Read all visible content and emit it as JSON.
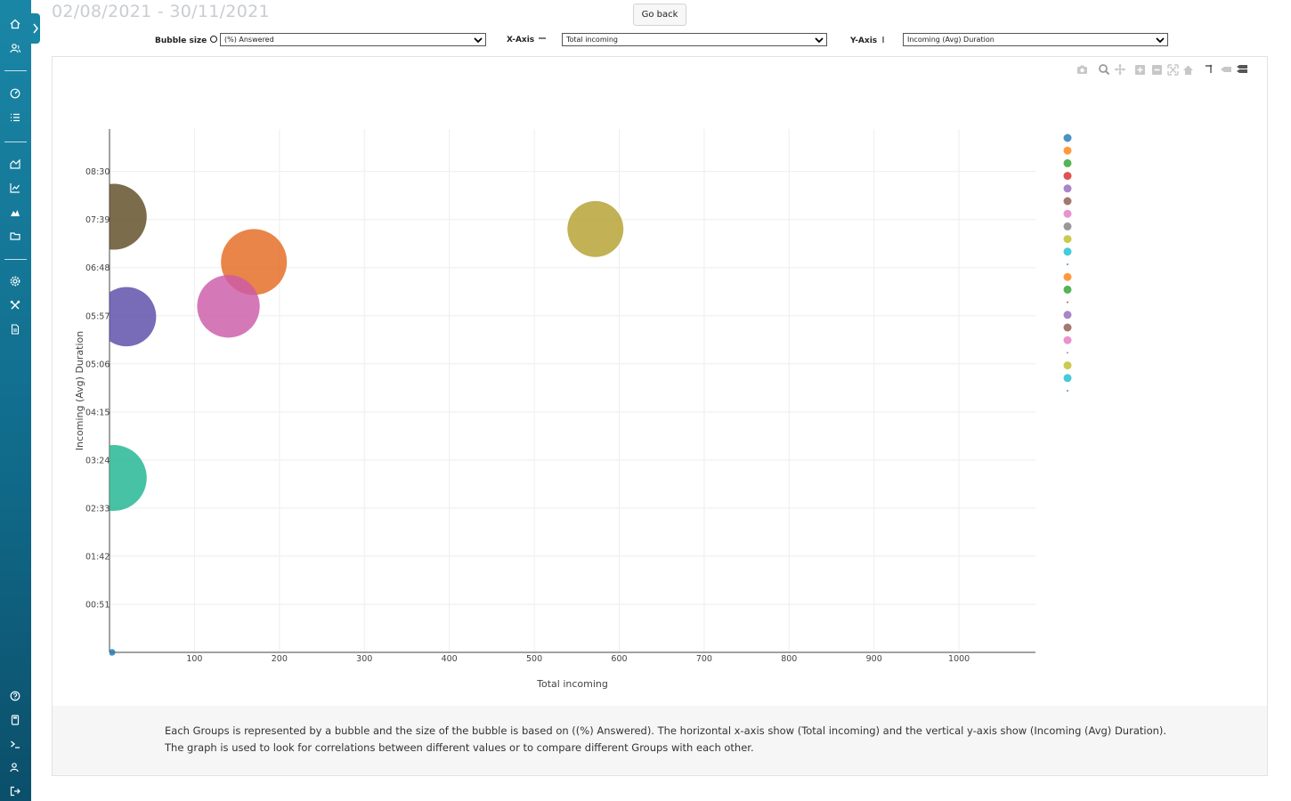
{
  "header": {
    "date_range": "02/08/2021 - 30/11/2021",
    "go_back_label": "Go back"
  },
  "controls": {
    "bubble_size": {
      "label": "Bubble size",
      "value": "(%) Answered"
    },
    "x_axis": {
      "label": "X-Axis",
      "value": "Total incoming"
    },
    "y_axis": {
      "label": "Y-Axis",
      "value": "Incoming (Avg) Duration"
    }
  },
  "sidebar": {
    "top_icons": [
      "home-icon",
      "user-group-icon"
    ],
    "middle_icons": [
      "dashboard-icon",
      "list-icon"
    ],
    "report_icons": [
      "area-chart-icon",
      "line-chart-icon",
      "mountain-chart-icon",
      "folder-icon"
    ],
    "settings_icons": [
      "gear-icon",
      "tools-icon",
      "document-icon"
    ],
    "bottom_icons": [
      "help-icon",
      "calculator-icon",
      "terminal-icon",
      "user-icon",
      "logout-icon"
    ]
  },
  "toolbar_icons": [
    "camera-icon",
    "zoom-icon",
    "pan-icon",
    "zoom-in-icon",
    "zoom-out-icon",
    "autoscale-icon",
    "reset-axes-icon",
    "spike-lines-icon",
    "compare-hover-icon",
    "closest-hover-icon"
  ],
  "chart_data": {
    "type": "scatter",
    "subtype": "bubble",
    "xlabel": "Total incoming",
    "ylabel": "Incoming (Avg) Duration",
    "xlim": [
      0,
      1090
    ],
    "ylim_seconds": [
      0,
      555
    ],
    "x_ticks": [
      100,
      200,
      300,
      400,
      500,
      600,
      700,
      800,
      900,
      1000
    ],
    "y_ticks": [
      {
        "value": 51,
        "label": "00:51"
      },
      {
        "value": 102,
        "label": "01:42"
      },
      {
        "value": 153,
        "label": "02:33"
      },
      {
        "value": 204,
        "label": "03:24"
      },
      {
        "value": 255,
        "label": "04:15"
      },
      {
        "value": 306,
        "label": "05:06"
      },
      {
        "value": 357,
        "label": "05:57"
      },
      {
        "value": 408,
        "label": "06:48"
      },
      {
        "value": 459,
        "label": "07:39"
      },
      {
        "value": 510,
        "label": "08:30"
      }
    ],
    "grid": true,
    "legend_position": "right",
    "legend_colors": [
      "#1f77b4",
      "#ff7f0e",
      "#2ca02c",
      "#d62728",
      "#9467bd",
      "#8c564b",
      "#e377c2",
      "#7f7f7f",
      "#bcbd22",
      "#17becf",
      "#1f77b4",
      "#ff7f0e",
      "#2ca02c",
      "#d62728",
      "#9467bd",
      "#8c564b",
      "#e377c2",
      "#7f7f7f",
      "#bcbd22",
      "#17becf",
      "#1f77b4"
    ],
    "bubbles": [
      {
        "x": 5,
        "y": 462,
        "color": "#5e4c24",
        "size": 100
      },
      {
        "x": 20,
        "y": 356,
        "color": "#5a4aa8",
        "size": 90
      },
      {
        "x": 170,
        "y": 414,
        "color": "#e46a20",
        "size": 100
      },
      {
        "x": 140,
        "y": 367,
        "color": "#cc5aa8",
        "size": 95
      },
      {
        "x": 572,
        "y": 449,
        "color": "#b5a030",
        "size": 85
      },
      {
        "x": 5,
        "y": 185,
        "color": "#20b590",
        "size": 100
      },
      {
        "x": 3,
        "y": 0,
        "color": "#1f77b4",
        "size": 10
      }
    ]
  },
  "description": {
    "line1": "Each Groups is represented by a bubble and the size of the bubble is based on ((%) Answered). The horizontal x-axis show (Total incoming) and the vertical y-axis show (Incoming (Avg) Duration).",
    "line2": "The graph is used to look for correlations between different values or to compare different Groups with each other."
  }
}
